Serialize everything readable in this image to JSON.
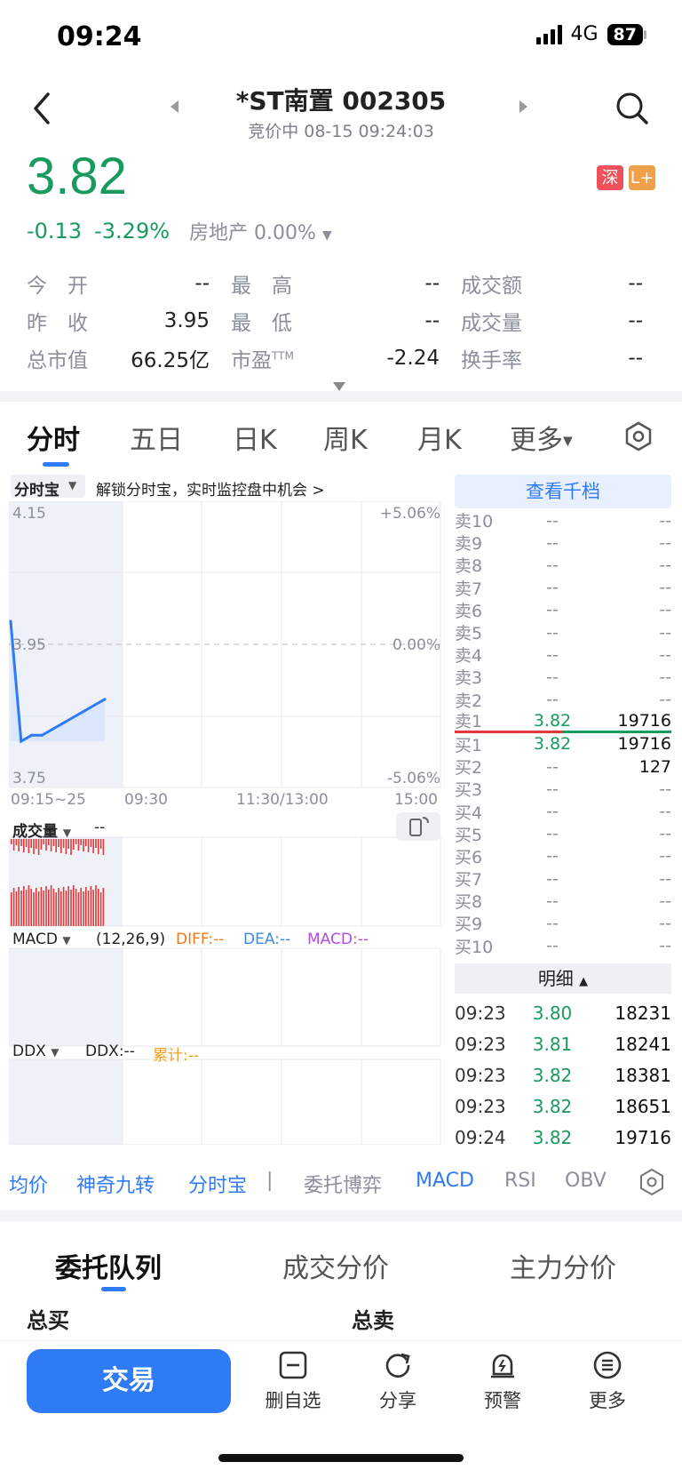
{
  "status_bar": {
    "time": "09:24",
    "network": "4G",
    "battery": "87"
  },
  "header": {
    "title": "*ST南置 002305",
    "subtitle": "竞价中 08-15 09:24:03"
  },
  "quote": {
    "price": "3.82",
    "change": "-0.13",
    "change_pct": "-3.29%",
    "sector": "房地产 0.00%",
    "badges": [
      "深",
      "L+"
    ],
    "colors": {
      "down": "#1a9a5e",
      "up": "#e13a3a",
      "accent": "#2f7af5"
    }
  },
  "stats": [
    [
      {
        "label": "今　开",
        "value": "--"
      },
      {
        "label": "最　高",
        "value": "--"
      },
      {
        "label": "成交额",
        "value": "--"
      }
    ],
    [
      {
        "label": "昨　收",
        "value": "3.95"
      },
      {
        "label": "最　低",
        "value": "--"
      },
      {
        "label": "成交量",
        "value": "--"
      }
    ],
    [
      {
        "label": "总市值",
        "value": "66.25亿"
      },
      {
        "label": "市盈",
        "sup": "TTM",
        "value": "-2.24"
      },
      {
        "label": "换手率",
        "value": "--"
      }
    ]
  ],
  "tabs": [
    "分时",
    "五日",
    "日K",
    "周K",
    "月K",
    "更多"
  ],
  "chart": {
    "selector_label": "分时宝",
    "promo": "解锁分时宝，实时监控盘中机会 >",
    "y_left": [
      "4.15",
      "3.95",
      "3.75"
    ],
    "y_right": [
      "+5.06%",
      "0.00%",
      "-5.06%"
    ],
    "x_labels": [
      "09:15~25",
      "09:30",
      "11:30/13:00",
      "15:00"
    ],
    "volume_label": "成交量",
    "volume_value": "--",
    "macd_label": "MACD",
    "macd_params": "(12,26,9)",
    "diff": "DIFF:--",
    "dea": "DEA:--",
    "macd": "MACD:--",
    "ddx_label": "DDX",
    "ddx": "DDX:--",
    "cumulative": "累计:--"
  },
  "chart_data": {
    "type": "line",
    "title": "",
    "xlabel": "",
    "ylabel": "",
    "x": [
      "09:15",
      "09:16",
      "09:17",
      "09:18",
      "09:19",
      "09:20",
      "09:21",
      "09:22",
      "09:23",
      "09:24"
    ],
    "series": [
      {
        "values": [
          3.95,
          3.75,
          3.76,
          3.76,
          3.77,
          3.78,
          3.79,
          3.8,
          3.81,
          3.82
        ]
      }
    ],
    "ylim": [
      3.75,
      4.15
    ],
    "baseline": 3.95
  },
  "order_book": {
    "header": "查看千档",
    "asks": [
      {
        "label": "卖10",
        "price": "--",
        "vol": "--"
      },
      {
        "label": "卖9",
        "price": "--",
        "vol": "--"
      },
      {
        "label": "卖8",
        "price": "--",
        "vol": "--"
      },
      {
        "label": "卖7",
        "price": "--",
        "vol": "--"
      },
      {
        "label": "卖6",
        "price": "--",
        "vol": "--"
      },
      {
        "label": "卖5",
        "price": "--",
        "vol": "--"
      },
      {
        "label": "卖4",
        "price": "--",
        "vol": "--"
      },
      {
        "label": "卖3",
        "price": "--",
        "vol": "--"
      },
      {
        "label": "卖2",
        "price": "--",
        "vol": "--"
      },
      {
        "label": "卖1",
        "price": "3.82",
        "vol": "19716"
      }
    ],
    "bids": [
      {
        "label": "买1",
        "price": "3.82",
        "vol": "19716"
      },
      {
        "label": "买2",
        "price": "--",
        "vol": "127"
      },
      {
        "label": "买3",
        "price": "--",
        "vol": "--"
      },
      {
        "label": "买4",
        "price": "--",
        "vol": "--"
      },
      {
        "label": "买5",
        "price": "--",
        "vol": "--"
      },
      {
        "label": "买6",
        "price": "--",
        "vol": "--"
      },
      {
        "label": "买7",
        "price": "--",
        "vol": "--"
      },
      {
        "label": "买8",
        "price": "--",
        "vol": "--"
      },
      {
        "label": "买9",
        "price": "--",
        "vol": "--"
      },
      {
        "label": "买10",
        "price": "--",
        "vol": "--"
      }
    ],
    "detail_header": "明细",
    "trades": [
      {
        "time": "09:23",
        "price": "3.80",
        "vol": "18231"
      },
      {
        "time": "09:23",
        "price": "3.81",
        "vol": "18241"
      },
      {
        "time": "09:23",
        "price": "3.82",
        "vol": "18381"
      },
      {
        "time": "09:23",
        "price": "3.82",
        "vol": "18651"
      },
      {
        "time": "09:24",
        "price": "3.82",
        "vol": "19716"
      }
    ]
  },
  "indicator_tabs": [
    "均价",
    "神奇九转",
    "分时宝",
    "委托博弈",
    "MACD",
    "RSI",
    "OBV"
  ],
  "bottom_tabs": [
    "委托队列",
    "成交分价",
    "主力分价"
  ],
  "queue": {
    "buy_total": "总买",
    "sell_total": "总卖"
  },
  "nav": {
    "trade": "交易",
    "items": [
      {
        "label": "删自选",
        "icon": "minus-square-icon"
      },
      {
        "label": "分享",
        "icon": "share-icon"
      },
      {
        "label": "预警",
        "icon": "alert-bell-icon"
      },
      {
        "label": "更多",
        "icon": "more-menu-icon"
      }
    ]
  }
}
